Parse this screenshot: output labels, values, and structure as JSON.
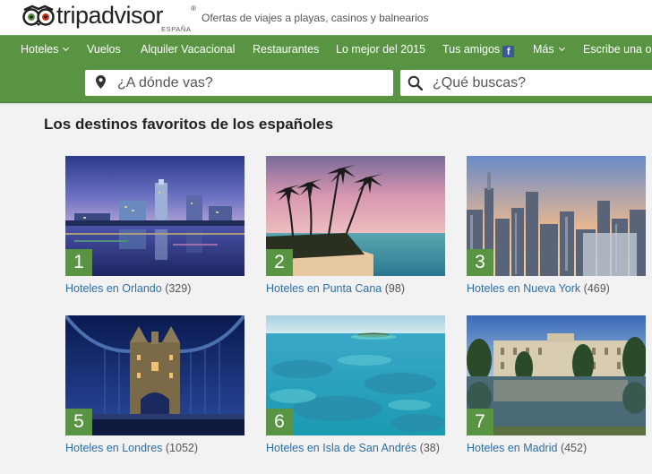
{
  "brand": {
    "name": "tripadvisor",
    "trademark": "®",
    "country": "ESPAÑA",
    "tagline": "Ofertas de viajes a playas, casinos y balnearios"
  },
  "nav": {
    "items": [
      {
        "label": "Hoteles"
      },
      {
        "label": "Vuelos"
      },
      {
        "label": "Alquiler Vacacional"
      },
      {
        "label": "Restaurantes"
      },
      {
        "label": "Lo mejor del 2015"
      },
      {
        "label": "Tus amigos"
      },
      {
        "label": "Más"
      },
      {
        "label": "Escribe una opinión"
      }
    ],
    "fb_glyph": "f"
  },
  "search": {
    "where_placeholder": "¿A dónde vas?",
    "what_placeholder": "¿Qué buscas?"
  },
  "section": {
    "title": "Los destinos favoritos de los españoles"
  },
  "destinations": [
    {
      "rank": "1",
      "link": "Hoteles en Orlando",
      "count": "(329)"
    },
    {
      "rank": "2",
      "link": "Hoteles en Punta Cana",
      "count": "(98)"
    },
    {
      "rank": "3",
      "link": "Hoteles en Nueva York",
      "count": "(469)"
    },
    {
      "rank": "5",
      "link": "Hoteles en Londres",
      "count": "(1052)"
    },
    {
      "rank": "6",
      "link": "Hoteles en Isla de San Andrés",
      "count": "(38)"
    },
    {
      "rank": "7",
      "link": "Hoteles en Madrid",
      "count": "(452)"
    }
  ],
  "colors": {
    "brand_green": "#589442",
    "link_blue": "#2c6ea8"
  }
}
